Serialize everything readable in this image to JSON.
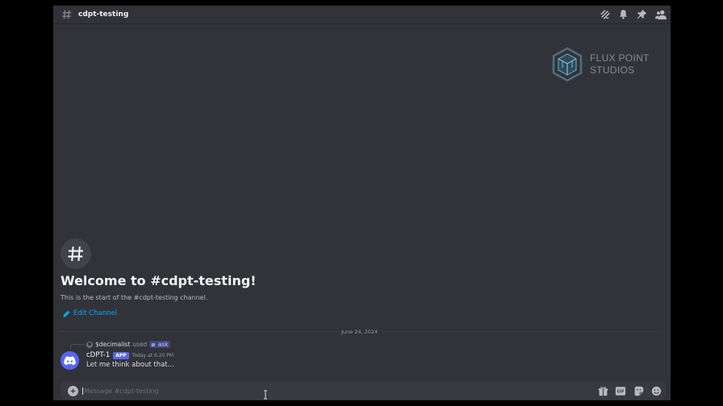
{
  "header": {
    "channel_name": "cdpt-testing",
    "icons": [
      "threads-icon",
      "bell-icon",
      "pin-icon",
      "members-icon"
    ]
  },
  "watermark": {
    "line1": "FLUX POINT",
    "line2": "STUDIOS"
  },
  "welcome": {
    "title": "Welcome to #cdpt-testing!",
    "subtitle": "This is the start of the #cdpt-testing channel.",
    "edit_label": "Edit Channel"
  },
  "divider": {
    "date": "June 24, 2024"
  },
  "message": {
    "reply_user": "$decimalist",
    "reply_used": "used",
    "reply_command": "ask",
    "author": "cDPT-1",
    "badge": "APP",
    "timestamp": "Today at 6:20 PM",
    "text": "Let me think about that..."
  },
  "composer": {
    "placeholder": "Message #cdpt-testing",
    "value": "",
    "icons": [
      "gift-icon",
      "gif-icon",
      "sticker-icon",
      "emoji-icon"
    ]
  },
  "colors": {
    "background": "#313338",
    "accent": "#5865f2",
    "link": "#00a8fc"
  }
}
